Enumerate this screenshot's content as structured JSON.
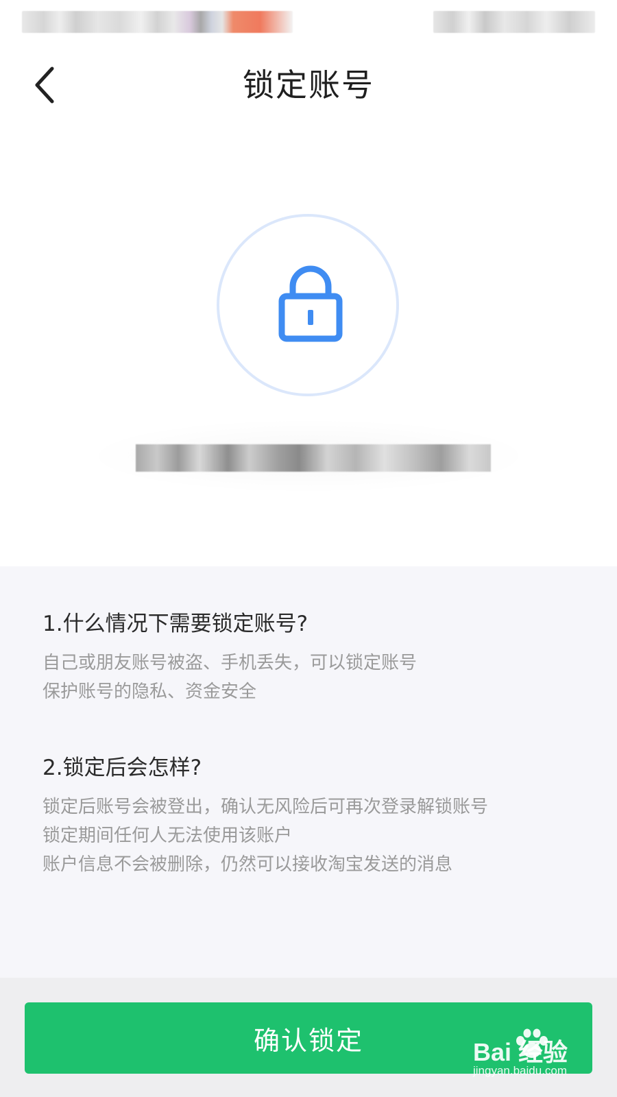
{
  "header": {
    "title": "锁定账号"
  },
  "info": {
    "q1": {
      "title": "1.什么情况下需要锁定账号?",
      "lines": [
        "自己或朋友账号被盗、手机丢失，可以锁定账号",
        "保护账号的隐私、资金安全"
      ]
    },
    "q2": {
      "title": "2.锁定后会怎样?",
      "lines": [
        "锁定后账号会被登出，确认无风险后可再次登录解锁账号",
        "锁定期间任何人无法使用该账户",
        "账户信息不会被删除，仍然可以接收淘宝发送的消息"
      ]
    }
  },
  "footer": {
    "confirm_label": "确认锁定"
  },
  "watermark": {
    "main": "Bai  经验",
    "sub": "jingyan.baidu.com"
  },
  "colors": {
    "accent_green": "#1ec16e",
    "lock_blue": "#3f8cf2",
    "circle_border": "#dbe7fb"
  },
  "icons": {
    "back": "chevron-left-icon",
    "lock": "lock-icon"
  }
}
